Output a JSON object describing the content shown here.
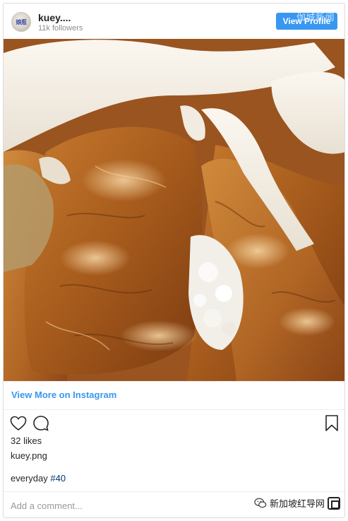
{
  "header": {
    "avatar_text": "娘惹",
    "user_name": "kuey....",
    "followers": "11k followers",
    "view_profile_label": "View Profile",
    "watermark_overlay": "伽城新闻"
  },
  "photo": {
    "alt": "kuey.png"
  },
  "view_more_label": "View More on Instagram",
  "actions": {
    "like_icon": "heart-outline-icon",
    "comment_icon": "speech-bubble-icon",
    "save_icon": "bookmark-outline-icon"
  },
  "likes": "32 likes",
  "caption_user": "kuey.png",
  "caption_text": "everyday ",
  "caption_hashtag": "#40",
  "comment": {
    "placeholder": "Add a comment...",
    "value": ""
  },
  "footer_watermark": {
    "text": "新加坡红导网",
    "icon": "wechat-bubble-icon"
  }
}
